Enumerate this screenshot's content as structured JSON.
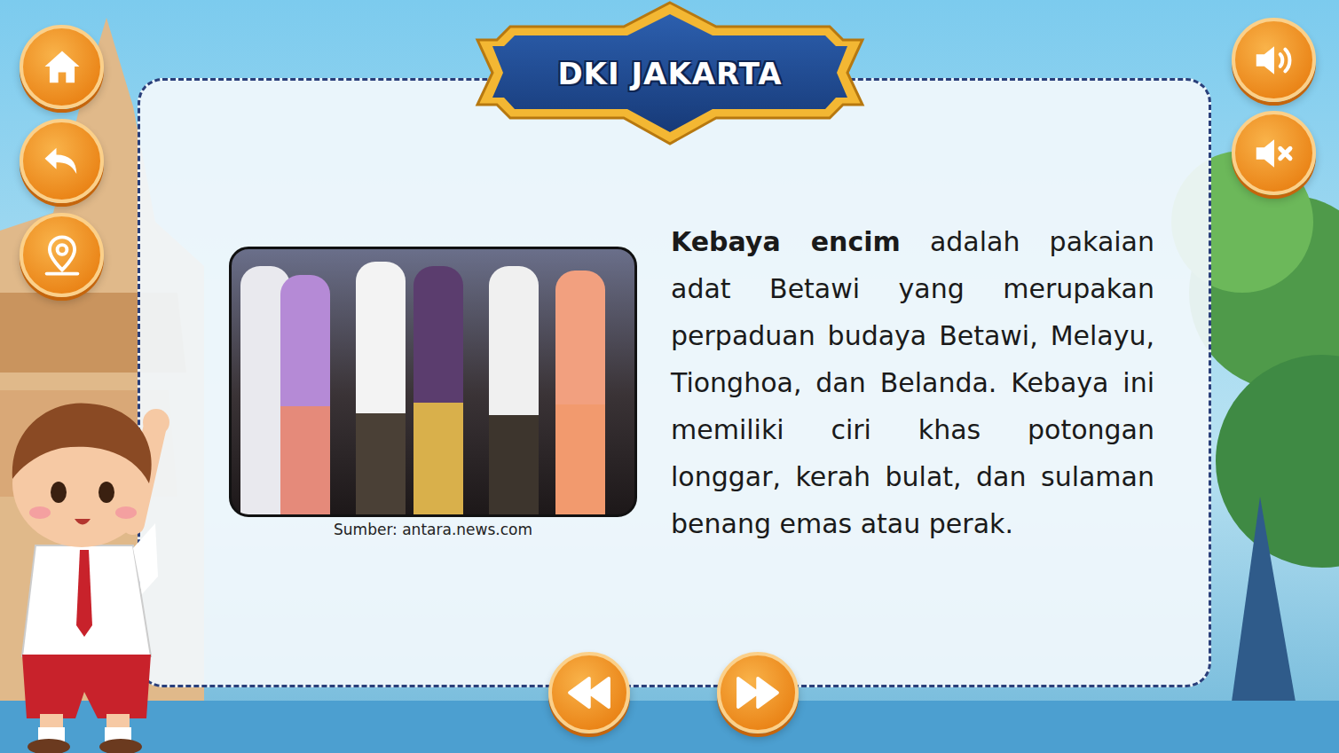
{
  "header": {
    "title": "DKI JAKARTA"
  },
  "content": {
    "image_caption": "Sumber: antara.news.com",
    "term": "Kebaya encim",
    "description": " adalah pakaian adat Betawi yang merupakan perpaduan budaya Betawi, Melayu, Tionghoa, dan Belanda. Kebaya ini memiliki ciri khas potongan longgar, kerah bulat, dan sulaman benang emas atau perak."
  }
}
